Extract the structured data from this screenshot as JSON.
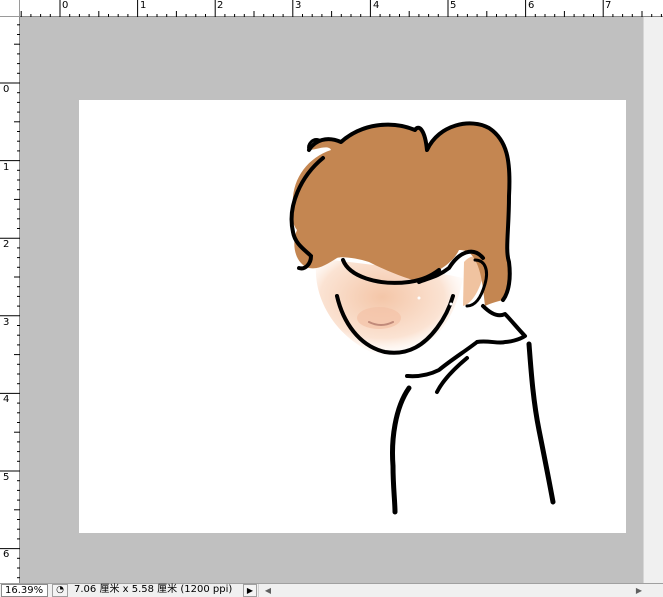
{
  "rulers": {
    "top_labels": [
      "0",
      "1",
      "2",
      "3",
      "4",
      "5",
      "6",
      "7"
    ],
    "left_labels": [
      "0",
      "1",
      "2",
      "3",
      "4",
      "5",
      "6"
    ]
  },
  "status": {
    "zoom": "16.39%",
    "doc_button_icon": "document-info-icon",
    "doc_info": "7.06 厘米 x 5.58 厘米 (1200 ppi)",
    "menu_arrow": "▶",
    "scroll_left": "◀",
    "scroll_right": "▶"
  },
  "colors": {
    "workspace": "#c0c0c0",
    "canvas": "#ffffff",
    "hair": "#c48651",
    "skin": "#f5cfb6",
    "ear": "#f0c3a0",
    "outline": "#000000"
  },
  "canvas": {
    "artwork": "character-drawing"
  }
}
